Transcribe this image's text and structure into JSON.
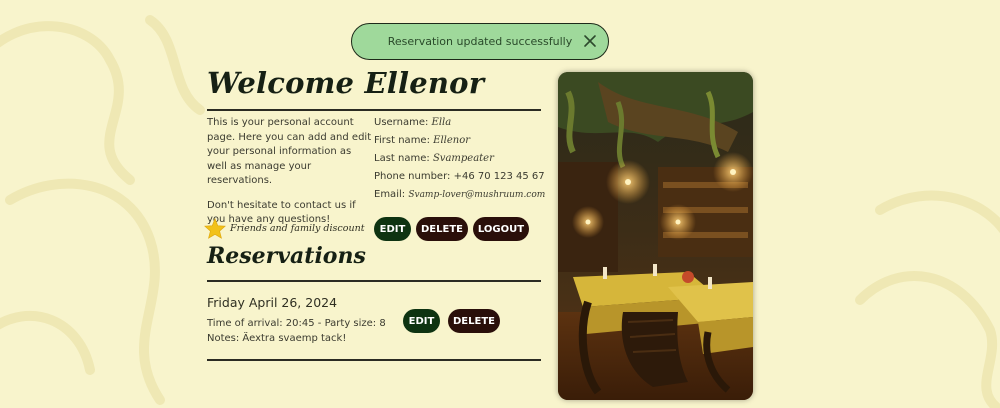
{
  "toast": {
    "message": "Reservation updated successfully"
  },
  "profile": {
    "title": "Welcome Ellenor",
    "intro_1": "This is your personal account page. Here you can add and edit your personal information as well as manage your reservations.",
    "intro_2": "Don't hesitate to contact us if you have any questions!",
    "discount": "Friends and family discount",
    "username_label": "Username:",
    "username": "Ella",
    "first_name_label": "First name:",
    "first_name": "Ellenor",
    "last_name_label": "Last name:",
    "last_name": "Svampeater",
    "phone_label": "Phone number:",
    "phone": "+46 70 123 45 67",
    "email_label": "Email:",
    "email": "Svamp-lover@mushruum.com",
    "edit_label": "EDIT",
    "delete_label": "DELETE",
    "logout_label": "LOGOUT"
  },
  "reservations": {
    "title": "Reservations",
    "items": [
      {
        "date": "Friday April 26, 2024",
        "details": "Time of arrival: 20:45 - Party size: 8",
        "notes": "Notes: Äextra svaemp tack!",
        "edit_label": "EDIT",
        "delete_label": "DELETE"
      }
    ]
  },
  "colors": {
    "background": "#f8f4cc",
    "toast": "#9fd99b",
    "edit_button": "#0e3311",
    "delete_button": "#2a0f0a"
  }
}
